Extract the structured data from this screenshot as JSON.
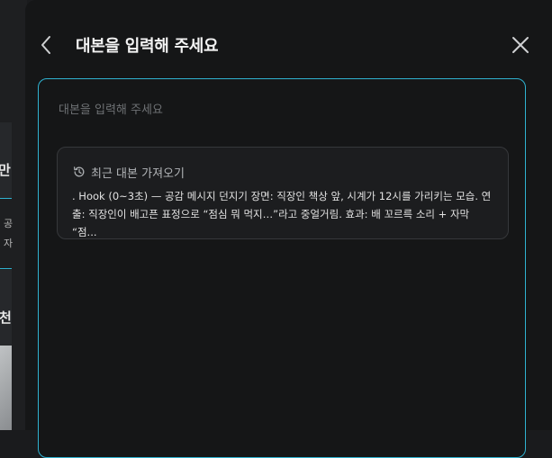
{
  "background": {
    "card1_char": "만",
    "card1_sub": [
      "공",
      "자"
    ],
    "card2_char": "천"
  },
  "modal": {
    "title": "대본을 입력해 주세요",
    "editor_placeholder": "대본을 입력해 주세요",
    "recent": {
      "label": "최근 대본 가져오기",
      "preview_line1": ". Hook (0~3초) — 공감 메시지 던지기 장면: 직장인 책상 앞, 시계가 12시를 가리키는 모습. 연",
      "preview_line2": "출: 직장인이 배고픈 표정으로 “점심 뭐 먹지…”라고 중얼거림. 효과: 배 꼬르륵 소리 + 자막 “점..."
    }
  },
  "colors": {
    "accent": "#2fb2d0",
    "modal_bg": "#151617",
    "card_bg": "#1c1d1f"
  },
  "icons": {
    "back": "chevron-left-icon",
    "close": "close-icon",
    "history": "history-icon"
  }
}
